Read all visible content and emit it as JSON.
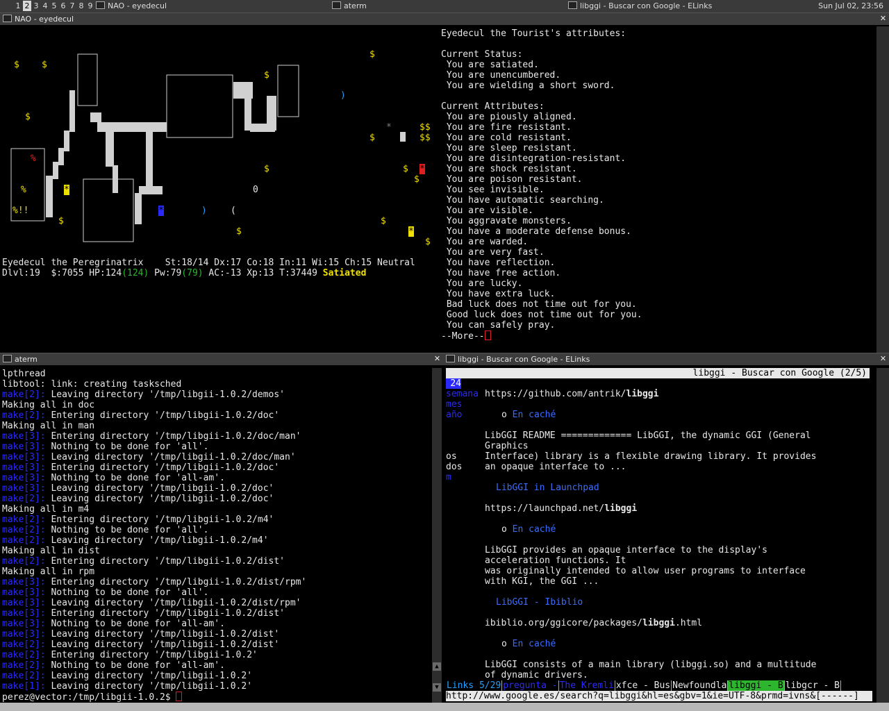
{
  "topbar": {
    "desktops": [
      "1",
      "2",
      "3",
      "4",
      "5",
      "6",
      "7",
      "8",
      "9"
    ],
    "tasks": [
      "NAO - eyedecul",
      "aterm",
      "libggi - Buscar con Google - ELinks"
    ],
    "clock": "Sun Jul 02, 23:56"
  },
  "nao": {
    "title": "NAO - eyedecul",
    "attributes": [
      "Eyedecul the Tourist's attributes:",
      "",
      "Current Status:",
      " You are satiated.",
      " You are unencumbered.",
      " You are wielding a short sword.",
      "",
      "Current Attributes:",
      " You are piously aligned.",
      " You are fire resistant.",
      " You are cold resistant.",
      " You are sleep resistant.",
      " You are disintegration-resistant.",
      " You are shock resistant.",
      " You are poison resistant.",
      " You see invisible.",
      " You have automatic searching.",
      " You are visible.",
      " You aggravate monsters.",
      " You have a moderate defense bonus.",
      " You are warded.",
      " You are very fast.",
      " You have reflection.",
      " You have free action.",
      " You are lucky.",
      " You have extra luck.",
      " Bad luck does not time out for you.",
      " Good luck does not time out for you.",
      " You can safely pray.",
      "--More--"
    ],
    "status1": "Eyedecul the Peregrinatrix    St:18/14 Dx:17 Co:18 In:11 Wi:15 Ch:15 Neutral",
    "status2": {
      "dlvl": "Dlvl:19  $:7055 HP:124",
      "hpmax": "(124)",
      "pw": " Pw:79",
      "pwmax": "(79)",
      "rest": " AC:-13 Xp:13 T:37449 ",
      "hunger": "Satiated"
    }
  },
  "aterm": {
    "title": "aterm",
    "lines": [
      [
        "",
        "lpthread"
      ],
      [
        "",
        "libtool: link: creating tasksched"
      ],
      [
        "make[2]:",
        " Leaving directory '/tmp/libgii-1.0.2/demos'"
      ],
      [
        "",
        "Making all in doc"
      ],
      [
        "make[2]:",
        " Entering directory '/tmp/libgii-1.0.2/doc'"
      ],
      [
        "",
        "Making all in man"
      ],
      [
        "make[3]:",
        " Entering directory '/tmp/libgii-1.0.2/doc/man'"
      ],
      [
        "make[3]:",
        " Nothing to be done for 'all'."
      ],
      [
        "make[3]:",
        " Leaving directory '/tmp/libgii-1.0.2/doc/man'"
      ],
      [
        "make[3]:",
        " Entering directory '/tmp/libgii-1.0.2/doc'"
      ],
      [
        "make[3]:",
        " Nothing to be done for 'all-am'."
      ],
      [
        "make[3]:",
        " Leaving directory '/tmp/libgii-1.0.2/doc'"
      ],
      [
        "make[2]:",
        " Leaving directory '/tmp/libgii-1.0.2/doc'"
      ],
      [
        "",
        "Making all in m4"
      ],
      [
        "make[2]:",
        " Entering directory '/tmp/libgii-1.0.2/m4'"
      ],
      [
        "make[2]:",
        " Nothing to be done for 'all'."
      ],
      [
        "make[2]:",
        " Leaving directory '/tmp/libgii-1.0.2/m4'"
      ],
      [
        "",
        "Making all in dist"
      ],
      [
        "make[2]:",
        " Entering directory '/tmp/libgii-1.0.2/dist'"
      ],
      [
        "",
        "Making all in rpm"
      ],
      [
        "make[3]:",
        " Entering directory '/tmp/libgii-1.0.2/dist/rpm'"
      ],
      [
        "make[3]:",
        " Nothing to be done for 'all'."
      ],
      [
        "make[3]:",
        " Leaving directory '/tmp/libgii-1.0.2/dist/rpm'"
      ],
      [
        "make[3]:",
        " Entering directory '/tmp/libgii-1.0.2/dist'"
      ],
      [
        "make[3]:",
        " Nothing to be done for 'all-am'."
      ],
      [
        "make[3]:",
        " Leaving directory '/tmp/libgii-1.0.2/dist'"
      ],
      [
        "make[2]:",
        " Leaving directory '/tmp/libgii-1.0.2/dist'"
      ],
      [
        "make[2]:",
        " Entering directory '/tmp/libgii-1.0.2'"
      ],
      [
        "make[2]:",
        " Nothing to be done for 'all-am'."
      ],
      [
        "make[2]:",
        " Leaving directory '/tmp/libgii-1.0.2'"
      ],
      [
        "make[1]:",
        " Leaving directory '/tmp/libgii-1.0.2'"
      ]
    ],
    "prompt": "perez@vector:/tmp/libgii-1.0.2$ "
  },
  "elinks": {
    "title": "libggi - Buscar con Google - ELinks",
    "header": "libggi - Buscar con Google (2/5)",
    "side": [
      "24",
      "semana",
      "mes",
      "año",
      "",
      "",
      "",
      "os",
      "dos",
      "m"
    ],
    "results": [
      {
        "url_pre": "https://github.com/antrik/",
        "url_bold": "libggi"
      },
      {
        "cache": "En caché"
      },
      {
        "snippet": [
          "LibGGI README ============= LibGGI, the dynamic GGI (General",
          "Graphics",
          "Interface) library is a flexible drawing library. It provides",
          "an opaque interface to ..."
        ]
      },
      {
        "title": "LibGGI in Launchpad"
      },
      {
        "url_pre": "https://launchpad.net/",
        "url_bold": "libggi"
      },
      {
        "cache": "En caché"
      },
      {
        "snippet": [
          "LibGGI provides an opaque interface to the display's",
          "acceleration functions. It",
          "was originally intended to allow user programs to interface",
          "with KGI, the GGI ..."
        ]
      },
      {
        "title": "LibGGI - Ibiblio"
      },
      {
        "url_pre": "ibiblio.org/ggicore/packages/",
        "url_bold": "libggi",
        "url_post": ".html"
      },
      {
        "cache": "En caché"
      },
      {
        "snippet": [
          "LibGGI consists of a main library (libggi.so) and a multitude",
          "of dynamic drivers."
        ]
      }
    ],
    "tabs": [
      "Links 5/29",
      "pregunta -",
      "The Kremli",
      "xfce - Bus",
      "Newfoundla",
      "libggi - B",
      "libgcr - B"
    ],
    "statusurl": "http://www.google.es/search?q=libggi&hl=es&gbv=1&ie=UTF-8&prmd=ivns&[------]"
  },
  "colors": {
    "make": "#2a2aff",
    "yellow": "#f0e000",
    "green": "#2db52d",
    "link": "#3b6cff",
    "red": "#e02020"
  }
}
